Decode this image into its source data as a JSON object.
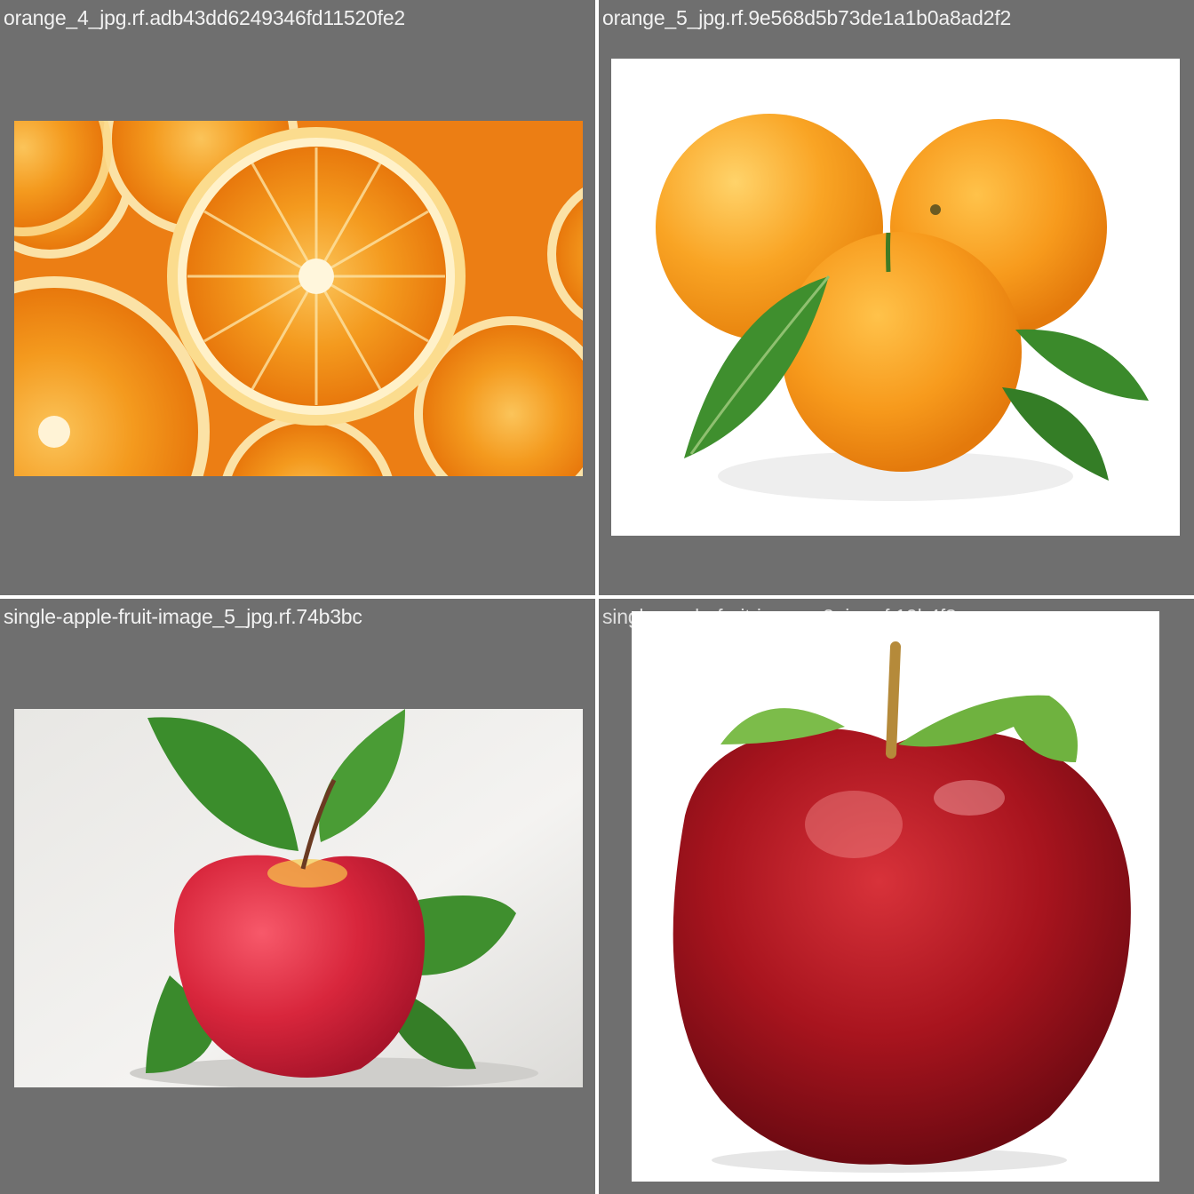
{
  "tiles": [
    {
      "label": "orange_4_jpg.rf.adb43dd6249346fd11520fe2",
      "content": "orange-slices-photo"
    },
    {
      "label": "orange_5_jpg.rf.9e568d5b73de1a1b0a8ad2f2",
      "content": "three-oranges-photo"
    },
    {
      "label": "single-apple-fruit-image_5_jpg.rf.74b3bc",
      "content": "apple-with-leaves-photo"
    },
    {
      "label": "single-apple-fruit-image_2_jpg.rf.19b4f3",
      "content": "red-apple-photo"
    }
  ],
  "colors": {
    "tile_background": "#6f6f6f",
    "label_text": "#f2f2f2",
    "orange": "#f48a14",
    "apple_red": "#b5141c",
    "leaf_green": "#3e8a2c"
  }
}
